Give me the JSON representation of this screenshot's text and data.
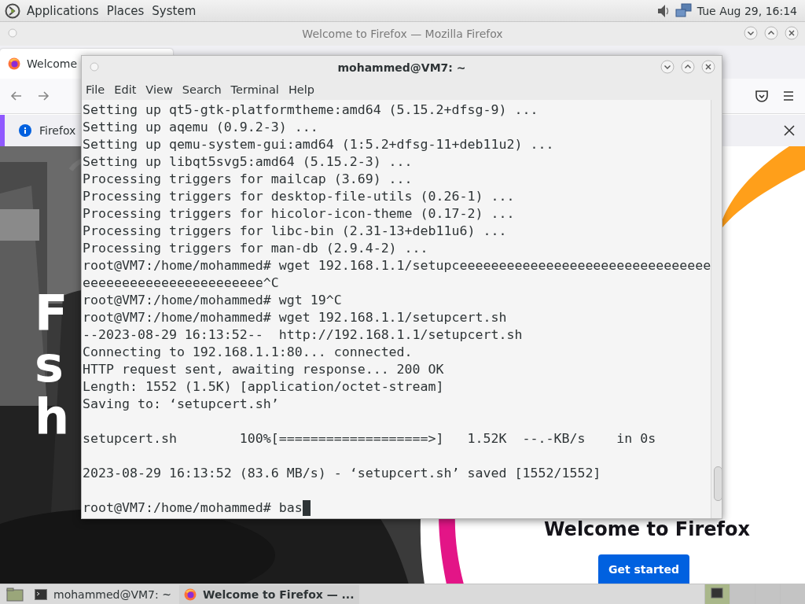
{
  "top_panel": {
    "menus": [
      "Applications",
      "Places",
      "System"
    ],
    "clock": "Tue Aug 29, 16:14"
  },
  "firefox": {
    "title": "Welcome to Firefox — Mozilla Firefox",
    "tab": {
      "label": "Welcome",
      "selected": true
    },
    "notification": "Firefox",
    "hero_letters": [
      "F",
      "s",
      "h"
    ],
    "heading": "Welcome to Firefox",
    "button": "Get started"
  },
  "terminal": {
    "title": "mohammed@VM7: ~",
    "menu": [
      "File",
      "Edit",
      "View",
      "Search",
      "Terminal",
      "Help"
    ],
    "lines": [
      {
        "text": "Setting up qt5-gtk-platformtheme:amd64 (5.15.2+dfsg-9) ..."
      },
      {
        "text": "Setting up aqemu (0.9.2-3) ..."
      },
      {
        "text": "Setting up qemu-system-gui:amd64 (1:5.2+dfsg-11+deb11u2) ..."
      },
      {
        "text": "Setting up libqt5svg5:amd64 (5.15.2-3) ..."
      },
      {
        "text": "Processing triggers for mailcap (3.69) ..."
      },
      {
        "text": "Processing triggers for desktop-file-utils (0.26-1) ..."
      },
      {
        "text": "Processing triggers for hicolor-icon-theme (0.17-2) ..."
      },
      {
        "text": "Processing triggers for libc-bin (2.31-13+deb11u6) ..."
      },
      {
        "text": "Processing triggers for man-db (2.9.4-2) ..."
      },
      {
        "text": "root@VM7:/home/mohammed# wget 192.168.1.1/setupceeeeeeeeeeeeeeeeeeeeeeeeeeeeeeee"
      },
      {
        "text": "eeeeeeeeeeeeeeeeeeeeeee^C"
      },
      {
        "text": "root@VM7:/home/mohammed# wgt 19^C"
      },
      {
        "text": "root@VM7:/home/mohammed# wget 192.168.1.1/setupcert.sh"
      },
      {
        "text": "--2023-08-29 16:13:52--  http://192.168.1.1/setupcert.sh"
      },
      {
        "text": "Connecting to 192.168.1.1:80... connected."
      },
      {
        "text": "HTTP request sent, awaiting response... 200 OK"
      },
      {
        "text": "Length: 1552 (1.5K) [application/octet-stream]"
      },
      {
        "text": "Saving to: ‘setupcert.sh’"
      },
      {
        "text": "setupcert.sh        100%[===================>]   1.52K  --.-KB/s    in 0s",
        "space_before": true
      },
      {
        "text": "2023-08-29 16:13:52 (83.6 MB/s) - ‘setupcert.sh’ saved [1552/1552]",
        "space_before": true
      },
      {
        "text": "root@VM7:/home/mohammed# bas",
        "space_before": true,
        "cursor": true
      }
    ]
  },
  "taskbar": {
    "tasks": [
      {
        "label": "mohammed@VM7: ~",
        "kind": "terminal",
        "selected": false
      },
      {
        "label": "Welcome to Firefox — ...",
        "kind": "browser",
        "selected": true
      }
    ],
    "workspaces": [
      {
        "selected": true
      },
      {
        "selected": false
      },
      {
        "selected": false
      },
      {
        "selected": false
      }
    ]
  }
}
